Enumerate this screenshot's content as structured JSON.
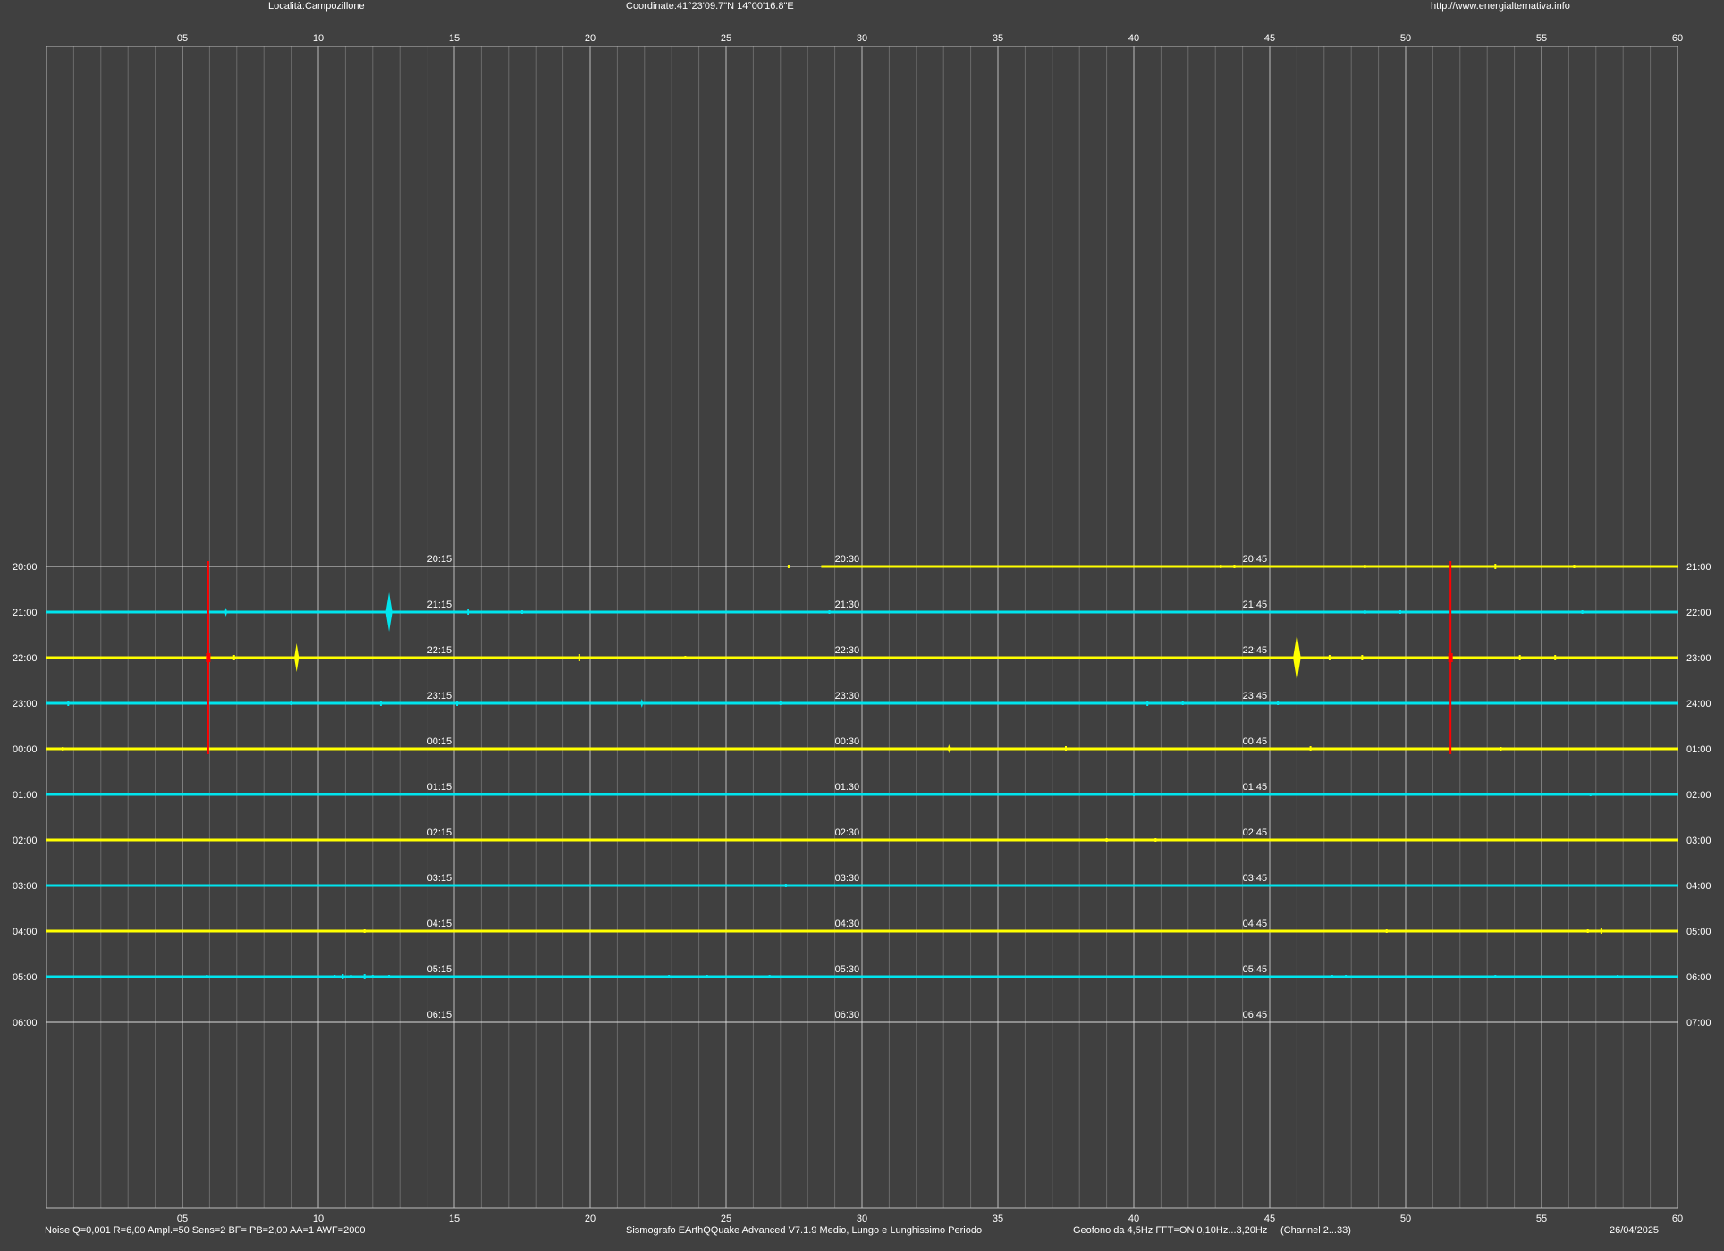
{
  "header": {
    "location": "Località:Campozillone",
    "coordinates": "Coordinate:41°23'09.7\"N 14°00'16.8\"E",
    "url": "http://www.energialternativa.info"
  },
  "footer": {
    "params": "Noise Q=0,001 R=6,00 Ampl.=50 Sens=2 BF= PB=2,00 AA=1 AWF=2000",
    "software": "Sismografo  EArthQQuake Advanced V7.1.9  Medio, Lungo e Lunghissimo Periodo",
    "geophone": "Geofono da 4,5Hz FFT=ON 0,10Hz...3,20Hz",
    "channel": "(Channel 2...33)",
    "date": "26/04/2025"
  },
  "colors": {
    "background": "#404040",
    "grid_major": "#bdbdbd",
    "grid_minor": "#6a6a6a",
    "trace_yellow": "#ffff00",
    "trace_cyan": "#00e5ee",
    "event_red": "#ff0000",
    "text": "#ffffff"
  },
  "chart_data": {
    "type": "line",
    "title": "",
    "xlabel": "",
    "ylabel": "",
    "xlim": [
      0,
      60
    ],
    "x_ticks": [
      "05",
      "10",
      "15",
      "20",
      "25",
      "30",
      "35",
      "40",
      "45",
      "50",
      "55",
      "60"
    ],
    "x_minor_step": 1,
    "grid": true,
    "row_labels_left": [
      "20:00",
      "21:00",
      "22:00",
      "23:00",
      "00:00",
      "01:00",
      "02:00",
      "03:00",
      "04:00",
      "05:00",
      "06:00"
    ],
    "row_labels_right": [
      "21:00",
      "22:00",
      "23:00",
      "24:00",
      "01:00",
      "02:00",
      "03:00",
      "04:00",
      "05:00",
      "06:00",
      "07:00"
    ],
    "quarter_labels": [
      [
        "20:15",
        "20:30",
        "20:45"
      ],
      [
        "21:15",
        "21:30",
        "21:45"
      ],
      [
        "22:15",
        "22:30",
        "22:45"
      ],
      [
        "23:15",
        "23:30",
        "23:45"
      ],
      [
        "00:15",
        "00:30",
        "00:45"
      ],
      [
        "01:15",
        "01:30",
        "01:45"
      ],
      [
        "02:15",
        "02:30",
        "02:45"
      ],
      [
        "03:15",
        "03:30",
        "03:45"
      ],
      [
        "04:15",
        "04:30",
        "04:45"
      ],
      [
        "05:15",
        "05:30",
        "05:45"
      ],
      [
        "06:15",
        "06:30",
        "06:45"
      ]
    ],
    "series": [
      {
        "row": 0,
        "color": "yellow",
        "start": 28.5,
        "end": 60,
        "events": [
          {
            "x": 27.3,
            "amp": 2
          },
          {
            "x": 43.2,
            "amp": 2
          },
          {
            "x": 43.7,
            "amp": 2
          },
          {
            "x": 48.5,
            "amp": 2
          },
          {
            "x": 53.3,
            "amp": 3
          },
          {
            "x": 56.2,
            "amp": 2
          }
        ]
      },
      {
        "row": 1,
        "color": "cyan",
        "start": 0,
        "end": 60,
        "events": [
          {
            "x": 6.6,
            "amp": 5
          },
          {
            "x": 12.6,
            "amp": 22
          },
          {
            "x": 15.5,
            "amp": 3
          },
          {
            "x": 17.5,
            "amp": 2
          },
          {
            "x": 28.8,
            "amp": 2
          },
          {
            "x": 48.5,
            "amp": 2
          },
          {
            "x": 49.8,
            "amp": 2
          },
          {
            "x": 56.5,
            "amp": 2
          }
        ]
      },
      {
        "row": 2,
        "color": "yellow",
        "start": 0,
        "end": 60,
        "events": [
          {
            "x": 5.9,
            "amp": 6
          },
          {
            "x": 6.9,
            "amp": 3
          },
          {
            "x": 9.2,
            "amp": 16
          },
          {
            "x": 19.6,
            "amp": 4
          },
          {
            "x": 23.5,
            "amp": 2
          },
          {
            "x": 46.0,
            "amp": 26
          },
          {
            "x": 47.2,
            "amp": 3
          },
          {
            "x": 48.4,
            "amp": 3
          },
          {
            "x": 54.2,
            "amp": 3
          },
          {
            "x": 55.5,
            "amp": 3
          }
        ]
      },
      {
        "row": 3,
        "color": "cyan",
        "start": 0,
        "end": 60,
        "events": [
          {
            "x": 0.8,
            "amp": 3
          },
          {
            "x": 9.0,
            "amp": 2
          },
          {
            "x": 12.3,
            "amp": 3
          },
          {
            "x": 15.1,
            "amp": 3
          },
          {
            "x": 21.9,
            "amp": 5
          },
          {
            "x": 27.0,
            "amp": 2
          },
          {
            "x": 40.5,
            "amp": 3
          },
          {
            "x": 41.8,
            "amp": 2
          },
          {
            "x": 45.3,
            "amp": 2
          }
        ]
      },
      {
        "row": 4,
        "color": "yellow",
        "start": 0,
        "end": 60,
        "events": [
          {
            "x": 0.6,
            "amp": 2
          },
          {
            "x": 33.2,
            "amp": 5
          },
          {
            "x": 37.5,
            "amp": 3
          },
          {
            "x": 46.5,
            "amp": 3
          },
          {
            "x": 53.5,
            "amp": 2
          }
        ]
      },
      {
        "row": 5,
        "color": "cyan",
        "start": 0,
        "end": 60,
        "events": [
          {
            "x": 40.0,
            "amp": 2
          },
          {
            "x": 56.8,
            "amp": 2
          }
        ]
      },
      {
        "row": 6,
        "color": "yellow",
        "start": 0,
        "end": 60,
        "events": [
          {
            "x": 39.0,
            "amp": 2
          },
          {
            "x": 40.8,
            "amp": 2
          }
        ]
      },
      {
        "row": 7,
        "color": "cyan",
        "start": 0,
        "end": 60,
        "events": [
          {
            "x": 27.2,
            "amp": 2
          }
        ]
      },
      {
        "row": 8,
        "color": "yellow",
        "start": 0,
        "end": 60,
        "events": [
          {
            "x": 11.7,
            "amp": 2
          },
          {
            "x": 49.3,
            "amp": 2
          },
          {
            "x": 56.7,
            "amp": 2
          },
          {
            "x": 57.2,
            "amp": 3
          }
        ]
      },
      {
        "row": 9,
        "color": "cyan",
        "start": 0,
        "end": 60,
        "events": [
          {
            "x": 5.9,
            "amp": 2
          },
          {
            "x": 10.6,
            "amp": 2
          },
          {
            "x": 10.9,
            "amp": 3
          },
          {
            "x": 11.2,
            "amp": 2
          },
          {
            "x": 11.7,
            "amp": 3
          },
          {
            "x": 12.0,
            "amp": 2
          },
          {
            "x": 12.6,
            "amp": 2
          },
          {
            "x": 22.9,
            "amp": 2
          },
          {
            "x": 24.3,
            "amp": 2
          },
          {
            "x": 26.6,
            "amp": 2
          },
          {
            "x": 47.3,
            "amp": 2
          },
          {
            "x": 47.8,
            "amp": 2
          },
          {
            "x": 53.3,
            "amp": 2
          },
          {
            "x": 57.8,
            "amp": 2
          }
        ]
      },
      {
        "row": 10,
        "color": "white",
        "start": 0,
        "end": 0,
        "events": []
      }
    ],
    "red_events": [
      {
        "x": 5.95,
        "from_row": 0,
        "to_row": 4
      },
      {
        "x": 51.65,
        "from_row": 0,
        "to_row": 4
      }
    ]
  }
}
